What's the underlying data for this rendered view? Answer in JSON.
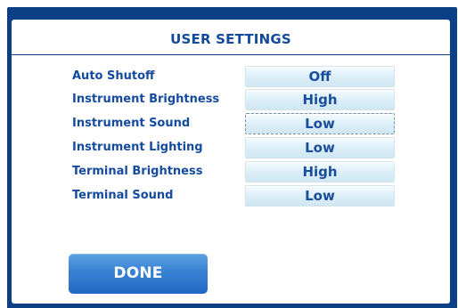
{
  "app": {
    "title": "USER SETTINGS"
  },
  "settings": [
    {
      "label": "Auto Shutoff",
      "value": "Off"
    },
    {
      "label": "Instrument Brightness",
      "value": "High"
    },
    {
      "label": "Instrument Sound",
      "value": "Low"
    },
    {
      "label": "Instrument Lighting",
      "value": "Low"
    },
    {
      "label": "Terminal Brightness",
      "value": "High"
    },
    {
      "label": "Terminal Sound",
      "value": "Low"
    }
  ],
  "actions": {
    "done_label": "DONE"
  },
  "colors": {
    "frame": "#0d3f86",
    "panel": "#ffffff",
    "text": "#144b9f",
    "button": "#d9edf8",
    "done_button": "#2f77cd"
  }
}
